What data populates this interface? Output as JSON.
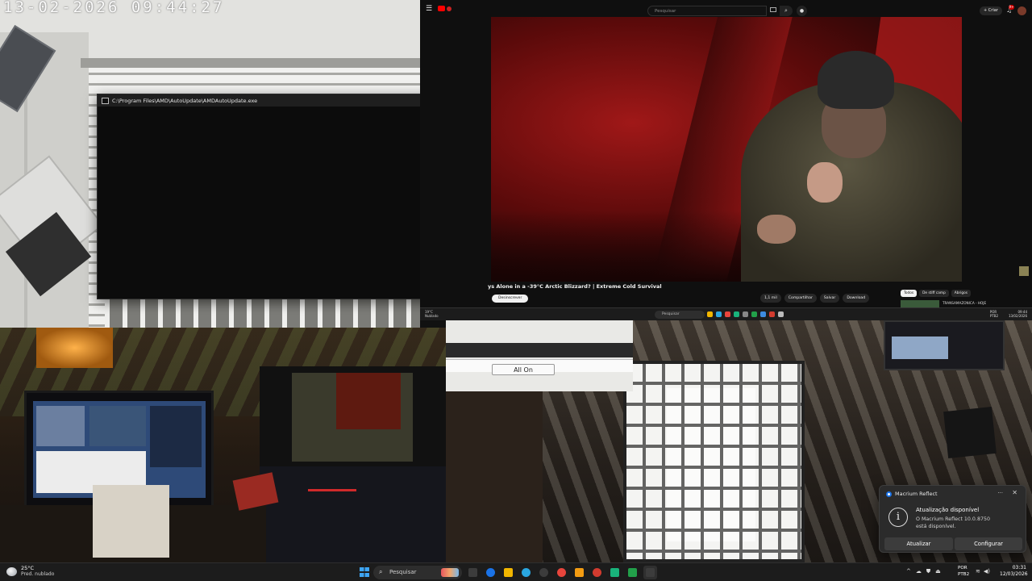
{
  "camera_top_left": {
    "timestamp": "13-02-2026 09:44:27"
  },
  "console_window": {
    "title": "C:\\Program Files\\AMD\\AutoUpdate\\AMDAutoUpdate.exe",
    "minimize": "–",
    "maximize": "☐",
    "close": "✕"
  },
  "youtube": {
    "search_placeholder": "Pesquisar",
    "create_label": "+ Criar",
    "notification_count": "9+",
    "video_title": "ys Alone in a -39°C Arctic Blizzard? | Extreme Cold Survival",
    "subscribe_label": "Desinscrever",
    "actions": [
      "1,1 mil",
      "Compartilhar",
      "Salvar",
      "Download"
    ],
    "chips": [
      "Todos",
      "De stiff camp",
      "Abrigos"
    ],
    "recommendation_title": "TRANSAMAZONICA - HOJE"
  },
  "remote_taskbar": {
    "weather": "19°C\nNublado",
    "search": "Pesquisar",
    "lang": "POR\nPTB2",
    "clock": "09:44\n13/02/2026"
  },
  "camera_bottom_right": {
    "button_label": "All On"
  },
  "toast": {
    "app_name": "Macrium Reflect",
    "more": "···",
    "close": "✕",
    "title": "Atualização disponível",
    "body": "O Macrium Reflect 10.0.8750 está disponível.",
    "update_button": "Atualizar",
    "config_button": "Configurar"
  },
  "taskbar": {
    "weather_temp": "25°C",
    "weather_desc": "Pred. nublado",
    "search_label": "Pesquisar",
    "lang_line1": "POR",
    "lang_line2": "PTB2",
    "time": "03:31",
    "date": "12/03/2026",
    "tray_chevron": "^",
    "app_colors": [
      "#3c3c3c",
      "#1a73e8",
      "#f2b600",
      "#2aa7e1",
      "#3c3c3c",
      "#e8453c",
      "#f39c12",
      "#d23b2f",
      "#19b37b",
      "#22a04a",
      "#3c3c3c"
    ]
  }
}
